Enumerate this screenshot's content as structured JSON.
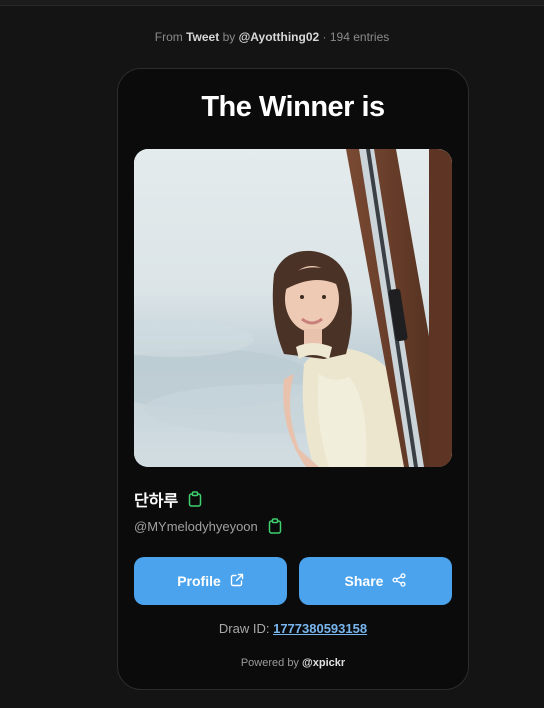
{
  "header": {
    "from_prefix": "From",
    "source": "Tweet",
    "by_word": "by",
    "author": "@Ayotthing02",
    "separator": "·",
    "entries": "194 entries"
  },
  "card": {
    "title": "The Winner is",
    "winner": {
      "name": "단하루",
      "handle": "@MYmelodyhyeyoon"
    },
    "buttons": {
      "profile_label": "Profile",
      "share_label": "Share"
    },
    "draw_id_label": "Draw ID:",
    "draw_id_value": "1777380593158",
    "powered_prefix": "Powered by",
    "powered_brand": "@xpickr"
  },
  "colors": {
    "accent": "#4aa3ec",
    "copy_icon": "#3ecf6e",
    "background": "#141414",
    "card": "#0b0b0c"
  },
  "icons": {
    "copy": "clipboard-icon",
    "external": "external-link-icon",
    "share": "share-nodes-icon"
  }
}
